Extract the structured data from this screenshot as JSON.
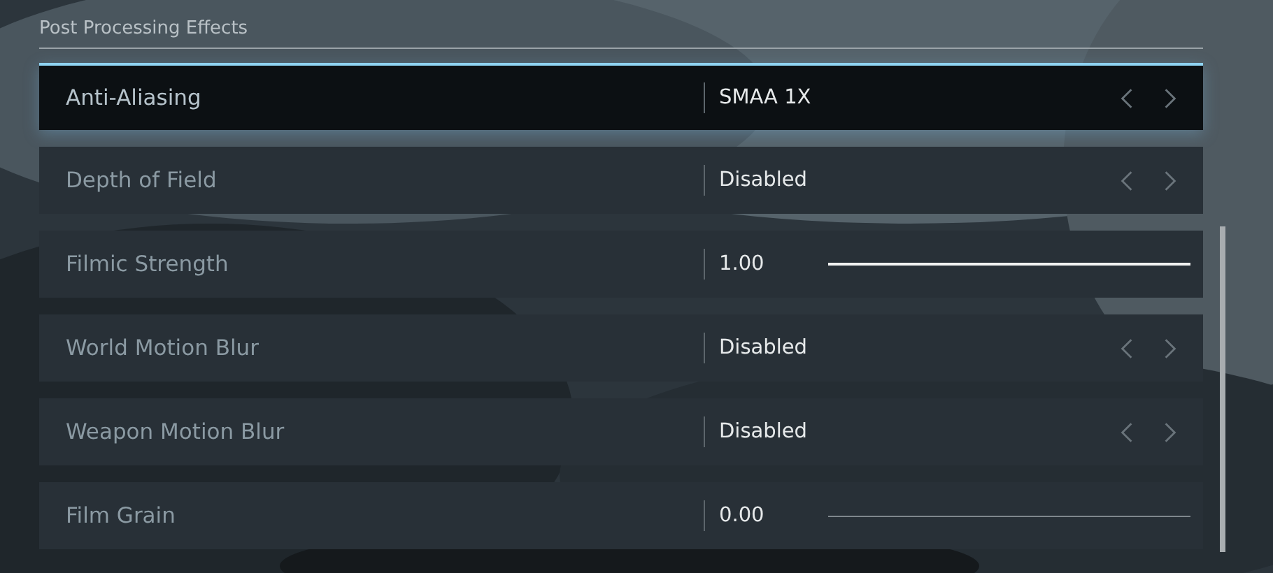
{
  "section": {
    "title": "Post Processing Effects"
  },
  "settings": [
    {
      "kind": "select",
      "label": "Anti-Aliasing",
      "value": "SMAA 1X",
      "selected": true
    },
    {
      "kind": "select",
      "label": "Depth of Field",
      "value": "Disabled",
      "selected": false
    },
    {
      "kind": "slider",
      "label": "Filmic Strength",
      "value": "1.00",
      "level": 1,
      "selected": false
    },
    {
      "kind": "select",
      "label": "World Motion Blur",
      "value": "Disabled",
      "selected": false
    },
    {
      "kind": "select",
      "label": "Weapon Motion Blur",
      "value": "Disabled",
      "selected": false
    },
    {
      "kind": "slider",
      "label": "Film Grain",
      "value": "0.00",
      "level": 0,
      "selected": false
    }
  ]
}
